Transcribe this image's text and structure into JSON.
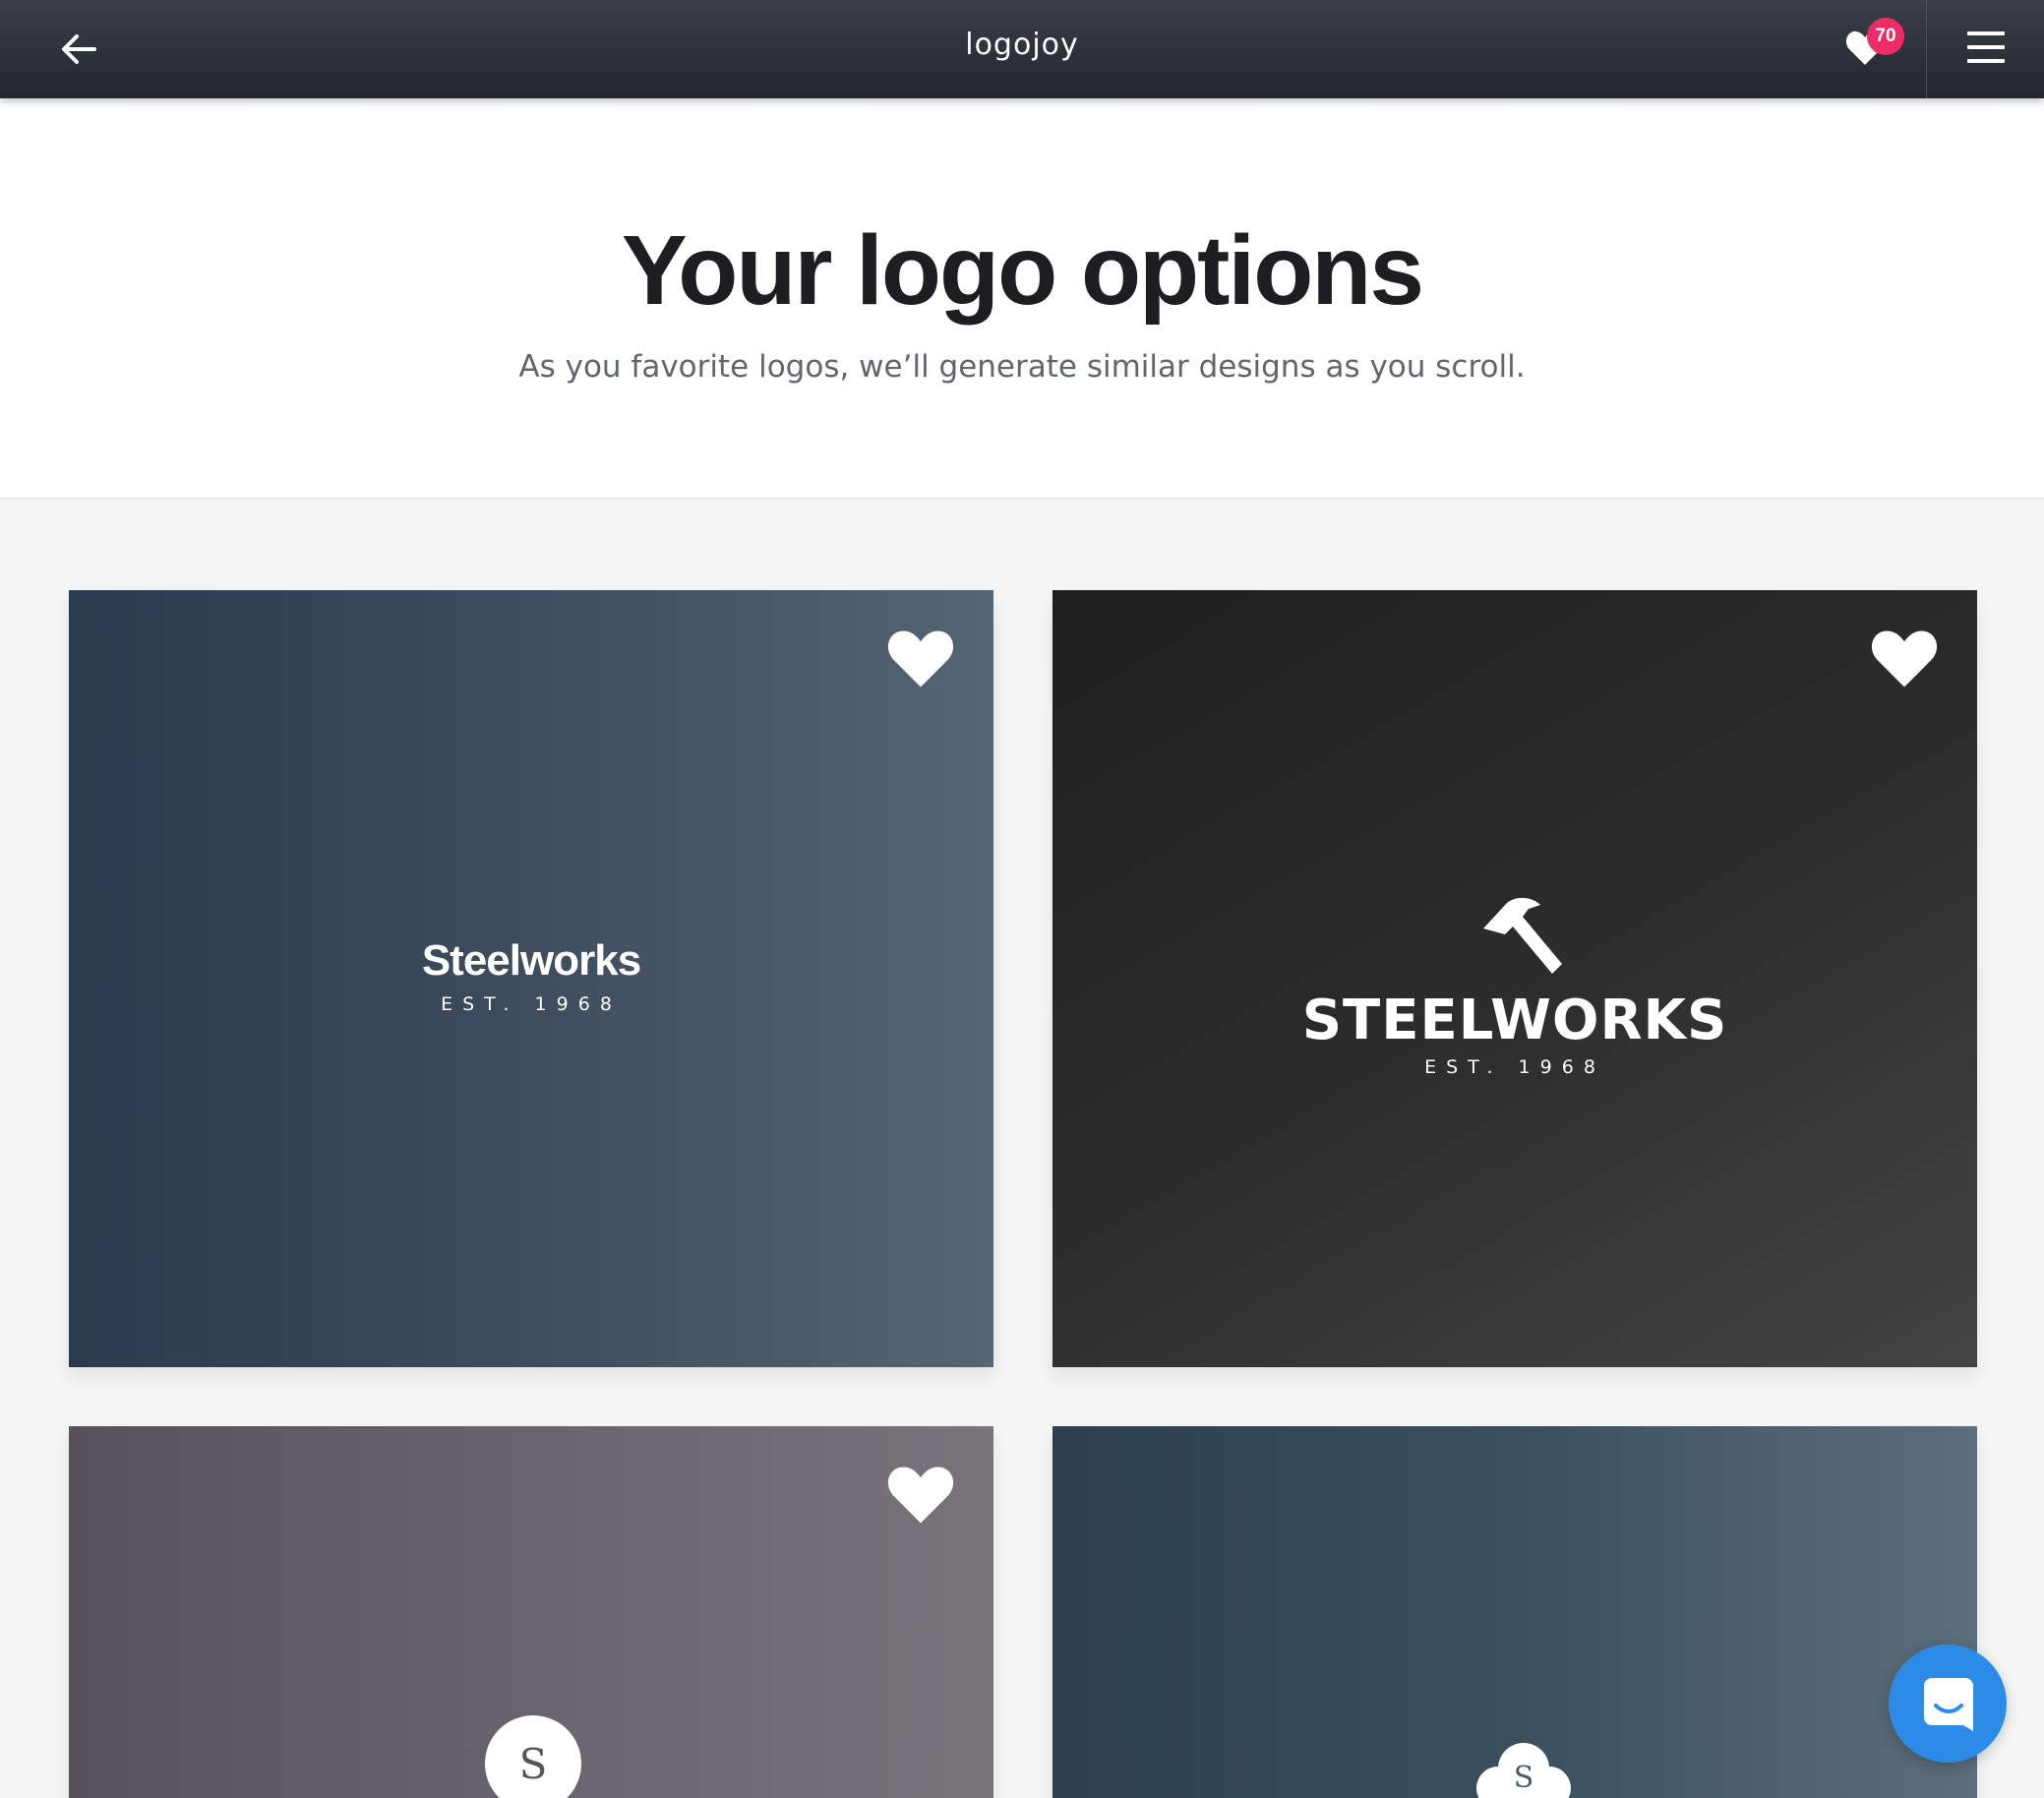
{
  "header": {
    "brand": "logojoy",
    "favorites_count": "70",
    "icons": [
      "back-arrow-icon",
      "heart-icon",
      "hamburger-menu-icon"
    ]
  },
  "hero": {
    "title": "Your logo options",
    "subtitle": "As you favorite logos, we’ll generate similar designs as you scroll."
  },
  "cards": [
    {
      "name": "Steelworks",
      "tagline": "EST. 1968",
      "favorited": true
    },
    {
      "name": "STEELWORKS",
      "tagline": "EST. 1968",
      "icon": "hammer-icon",
      "favorited": true
    },
    {
      "monogram": "S",
      "icon": "circle-monogram",
      "favorited": true
    },
    {
      "monogram": "S",
      "icon": "cloud-icon",
      "favorited": false
    }
  ],
  "colors": {
    "badge": "#ee2d67",
    "chat": "#2b8be6",
    "topbar": "#2c3038"
  },
  "chat": {
    "icon": "chat-bubble-icon"
  }
}
